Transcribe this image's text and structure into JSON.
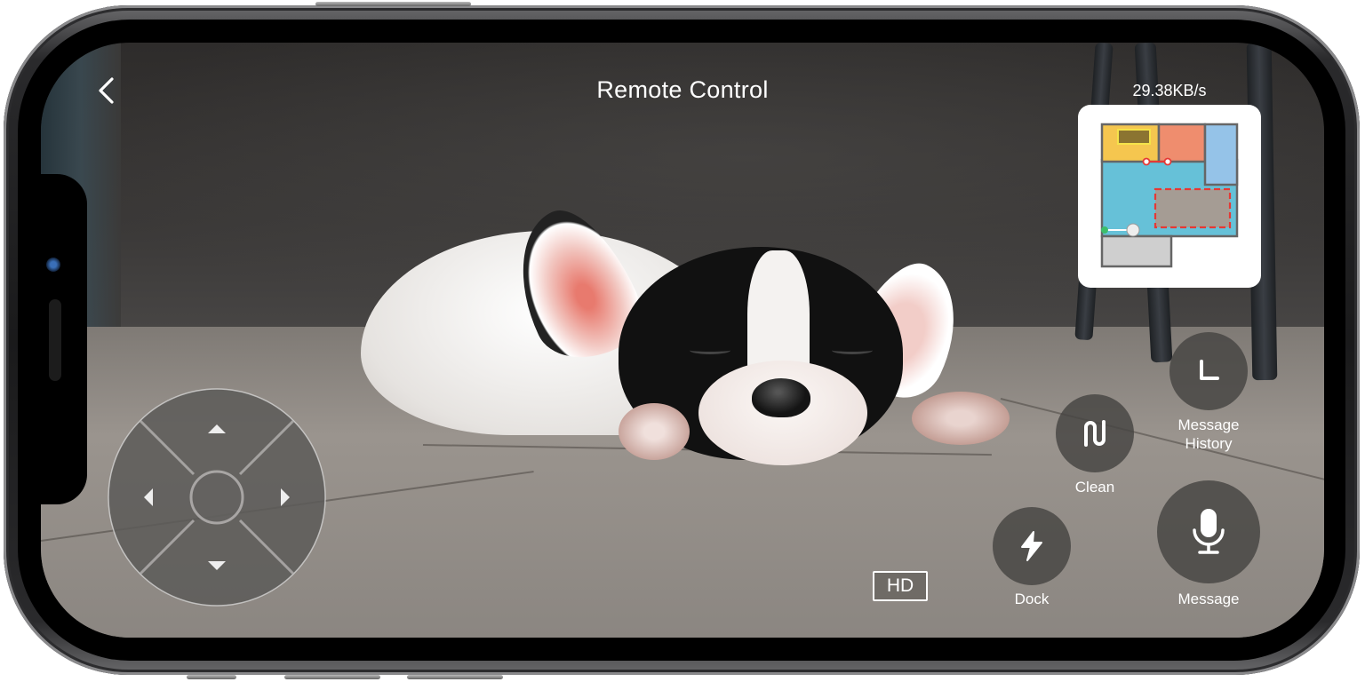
{
  "header": {
    "title": "Remote Control",
    "back_icon": "chevron-left-icon",
    "transfer_rate": "29.38KB/s"
  },
  "map": {
    "label": "floor-map-minimap",
    "colors": {
      "room_yellow": "#f5c64f",
      "room_orange": "#ef8d6e",
      "room_blue": "#95c3e8",
      "room_cyan": "#66c1d8",
      "room_gray": "#cfcfcf",
      "no_go_zone": "#a59c94",
      "no_go_border": "#e53935",
      "furniture": "#8b7431",
      "wall": "#666666",
      "dock": "#3dbd6a"
    }
  },
  "dpad": {
    "up_icon": "triangle-up-icon",
    "down_icon": "triangle-down-icon",
    "left_icon": "triangle-left-icon",
    "right_icon": "triangle-right-icon"
  },
  "controls": {
    "history": {
      "label_line1": "Message",
      "label_line2": "History",
      "icon": "clock-hands-icon"
    },
    "clean": {
      "label": "Clean",
      "icon": "clean-path-icon"
    },
    "dock": {
      "label": "Dock",
      "icon": "lightning-bolt-icon"
    },
    "message": {
      "label": "Message",
      "icon": "microphone-icon"
    },
    "quality": {
      "label": "HD"
    }
  }
}
